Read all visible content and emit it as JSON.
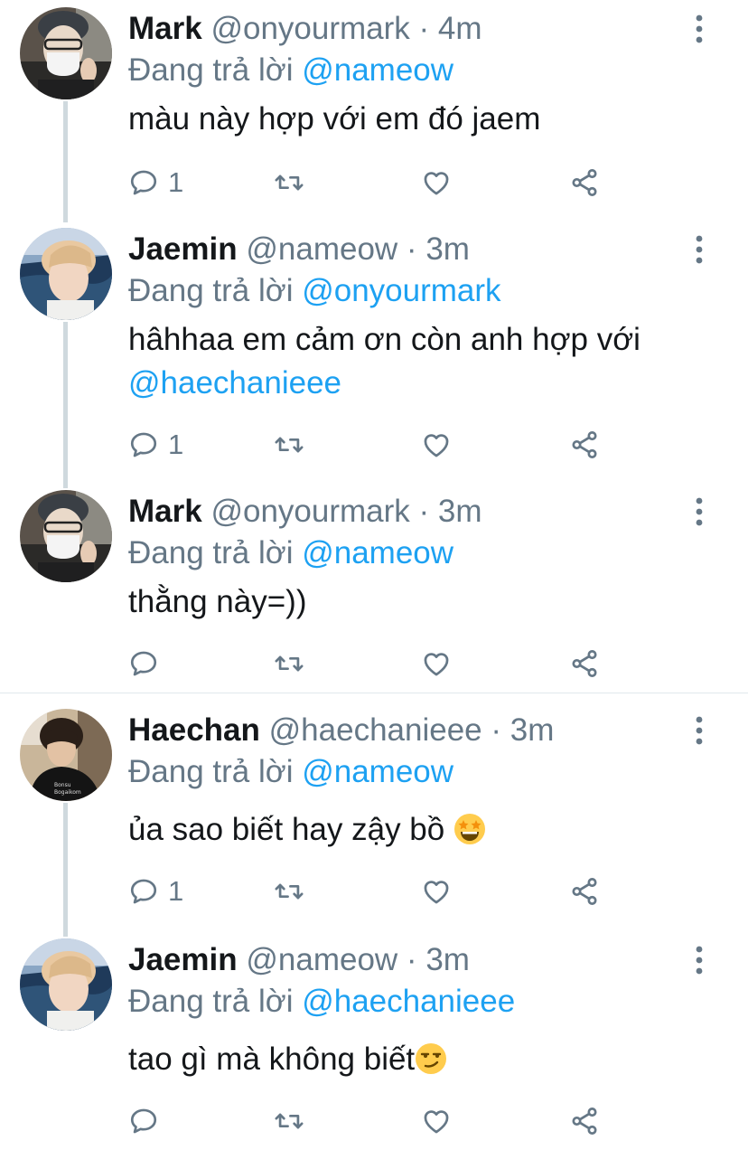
{
  "tweets": [
    {
      "name": "Mark",
      "handle": "@onyourmark",
      "sep": "·",
      "time": "4m",
      "replying_prefix": "Đang trả lời",
      "replying_to": "@nameow",
      "text": "màu này hợp với em đó jaem",
      "reply_count": "1",
      "avatar": "mark-avatar"
    },
    {
      "name": "Jaemin",
      "handle": "@nameow",
      "sep": "·",
      "time": "3m",
      "replying_prefix": "Đang trả lời",
      "replying_to": "@onyourmark",
      "text": "hâhhaa em cảm ơn còn anh hợp với",
      "text_mention": "@haechanieee",
      "reply_count": "1",
      "avatar": "jaemin-avatar"
    },
    {
      "name": "Mark",
      "handle": "@onyourmark",
      "sep": "·",
      "time": "3m",
      "replying_prefix": "Đang trả lời",
      "replying_to": "@nameow",
      "text": "thằng này=))",
      "reply_count": "",
      "avatar": "mark-avatar"
    },
    {
      "name": "Haechan",
      "handle": "@haechanieee",
      "sep": "·",
      "time": "3m",
      "replying_prefix": "Đang trả lời",
      "replying_to": "@nameow",
      "text": "ủa sao biết hay zậy bồ",
      "emoji": "star-struck-emoji",
      "reply_count": "1",
      "avatar": "haechan-avatar"
    },
    {
      "name": "Jaemin",
      "handle": "@nameow",
      "sep": "·",
      "time": "3m",
      "replying_prefix": "Đang trả lời",
      "replying_to": "@haechanieee",
      "text": "tao gì mà không biết",
      "emoji": "smirk-emoji",
      "reply_count": "",
      "avatar": "jaemin-avatar"
    }
  ],
  "colors": {
    "link": "#1da1f2",
    "secondary": "#657786",
    "thread_line": "#cfd9de"
  }
}
